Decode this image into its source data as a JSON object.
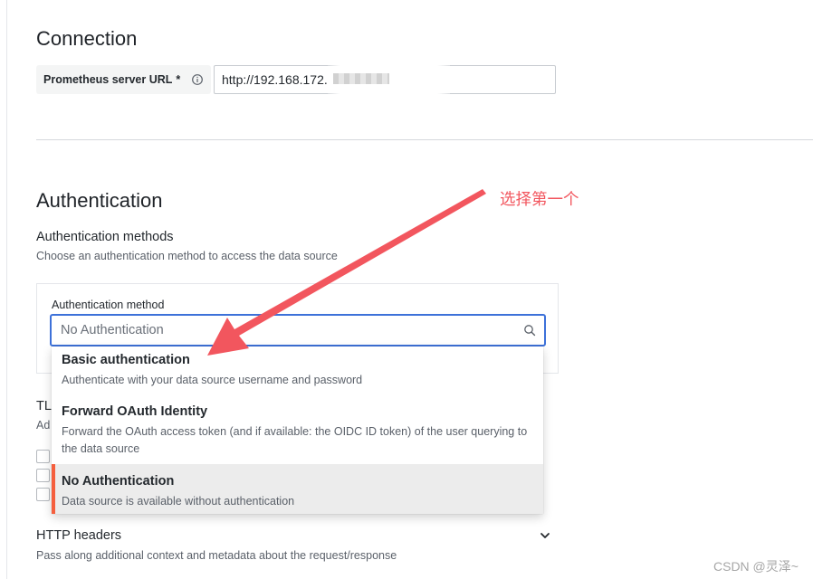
{
  "connection": {
    "title": "Connection",
    "url_label": "Prometheus server URL",
    "url_required_mark": "*",
    "url_value": "http://192.168.172."
  },
  "authentication": {
    "title": "Authentication",
    "methods_label": "Authentication methods",
    "methods_description": "Choose an authentication method to access the data source",
    "method_field_label": "Authentication method",
    "method_selected": "No Authentication",
    "options": [
      {
        "title": "Basic authentication",
        "description": "Authenticate with your data source username and password"
      },
      {
        "title": "Forward OAuth Identity",
        "description": "Forward the OAuth access token (and if available: the OIDC ID token) of the user querying to the data source"
      },
      {
        "title": "No Authentication",
        "description": "Data source is available without authentication",
        "selected": true
      }
    ]
  },
  "tls": {
    "label_visible": "TL",
    "description_visible": "Ad"
  },
  "http_headers": {
    "label": "HTTP headers",
    "description": "Pass along additional context and metadata about the request/response"
  },
  "annotation": {
    "text": "选择第一个",
    "color": "#f2565e"
  },
  "watermark": "CSDN @灵泽~",
  "colors": {
    "focus_border": "#3d71d9",
    "selected_bar": "#f55f3e",
    "arrow": "#f2565e"
  },
  "icons": {
    "url_info": "info-icon",
    "select_search": "search-icon",
    "http_toggle": "chevron-down-icon"
  }
}
